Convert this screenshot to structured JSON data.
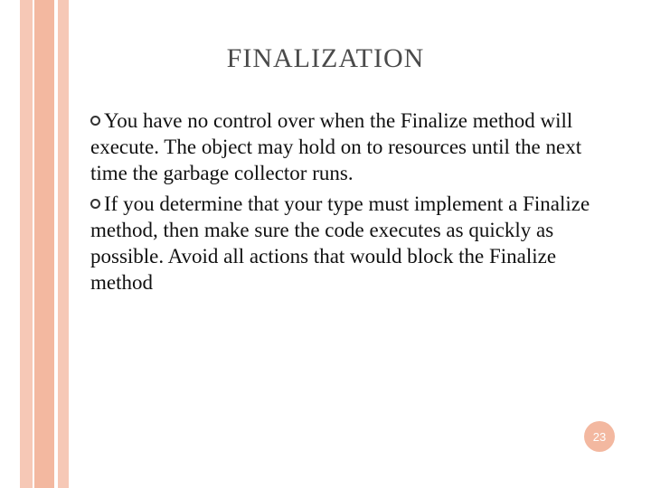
{
  "title": "FINALIZATION",
  "bullets": [
    "You have no control over when the Finalize method will execute. The object may hold on to resources until the next time the garbage collector runs.",
    "If you determine that your type must implement a Finalize method, then make sure the code executes as quickly as possible. Avoid all actions that would block the Finalize method"
  ],
  "page_number": "23",
  "colors": {
    "stripe_light": "#f6c8b6",
    "stripe_dark": "#f3b8a0",
    "title": "#4a4a4a"
  }
}
